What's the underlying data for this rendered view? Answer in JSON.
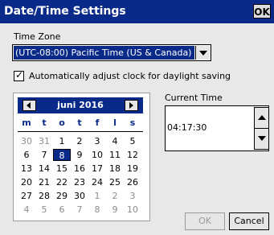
{
  "window": {
    "title": "Date/Time Settings",
    "ok_label": "OK"
  },
  "timezone": {
    "label": "Time Zone",
    "selected": "(UTC-08:00) Pacific Time (US & Canada)"
  },
  "dst": {
    "label": "Automatically adjust clock for daylight saving",
    "checked": true
  },
  "calendar": {
    "month_label": "juni 2016",
    "weekdays": [
      "m",
      "t",
      "o",
      "t",
      "f",
      "l",
      "s"
    ],
    "weeks": [
      [
        "30",
        "31",
        "1",
        "2",
        "3",
        "4",
        "5"
      ],
      [
        "6",
        "7",
        "8",
        "9",
        "10",
        "11",
        "12"
      ],
      [
        "13",
        "14",
        "15",
        "16",
        "17",
        "18",
        "19"
      ],
      [
        "20",
        "21",
        "22",
        "23",
        "24",
        "25",
        "26"
      ],
      [
        "27",
        "28",
        "29",
        "30",
        "1",
        "2",
        "3"
      ],
      [
        "4",
        "5",
        "6",
        "7",
        "8",
        "9",
        "10"
      ]
    ],
    "selected_day": "8"
  },
  "time": {
    "label": "Current Time",
    "value": "04:17:30"
  },
  "buttons": {
    "ok_label": "OK",
    "cancel_label": "Cancel"
  }
}
